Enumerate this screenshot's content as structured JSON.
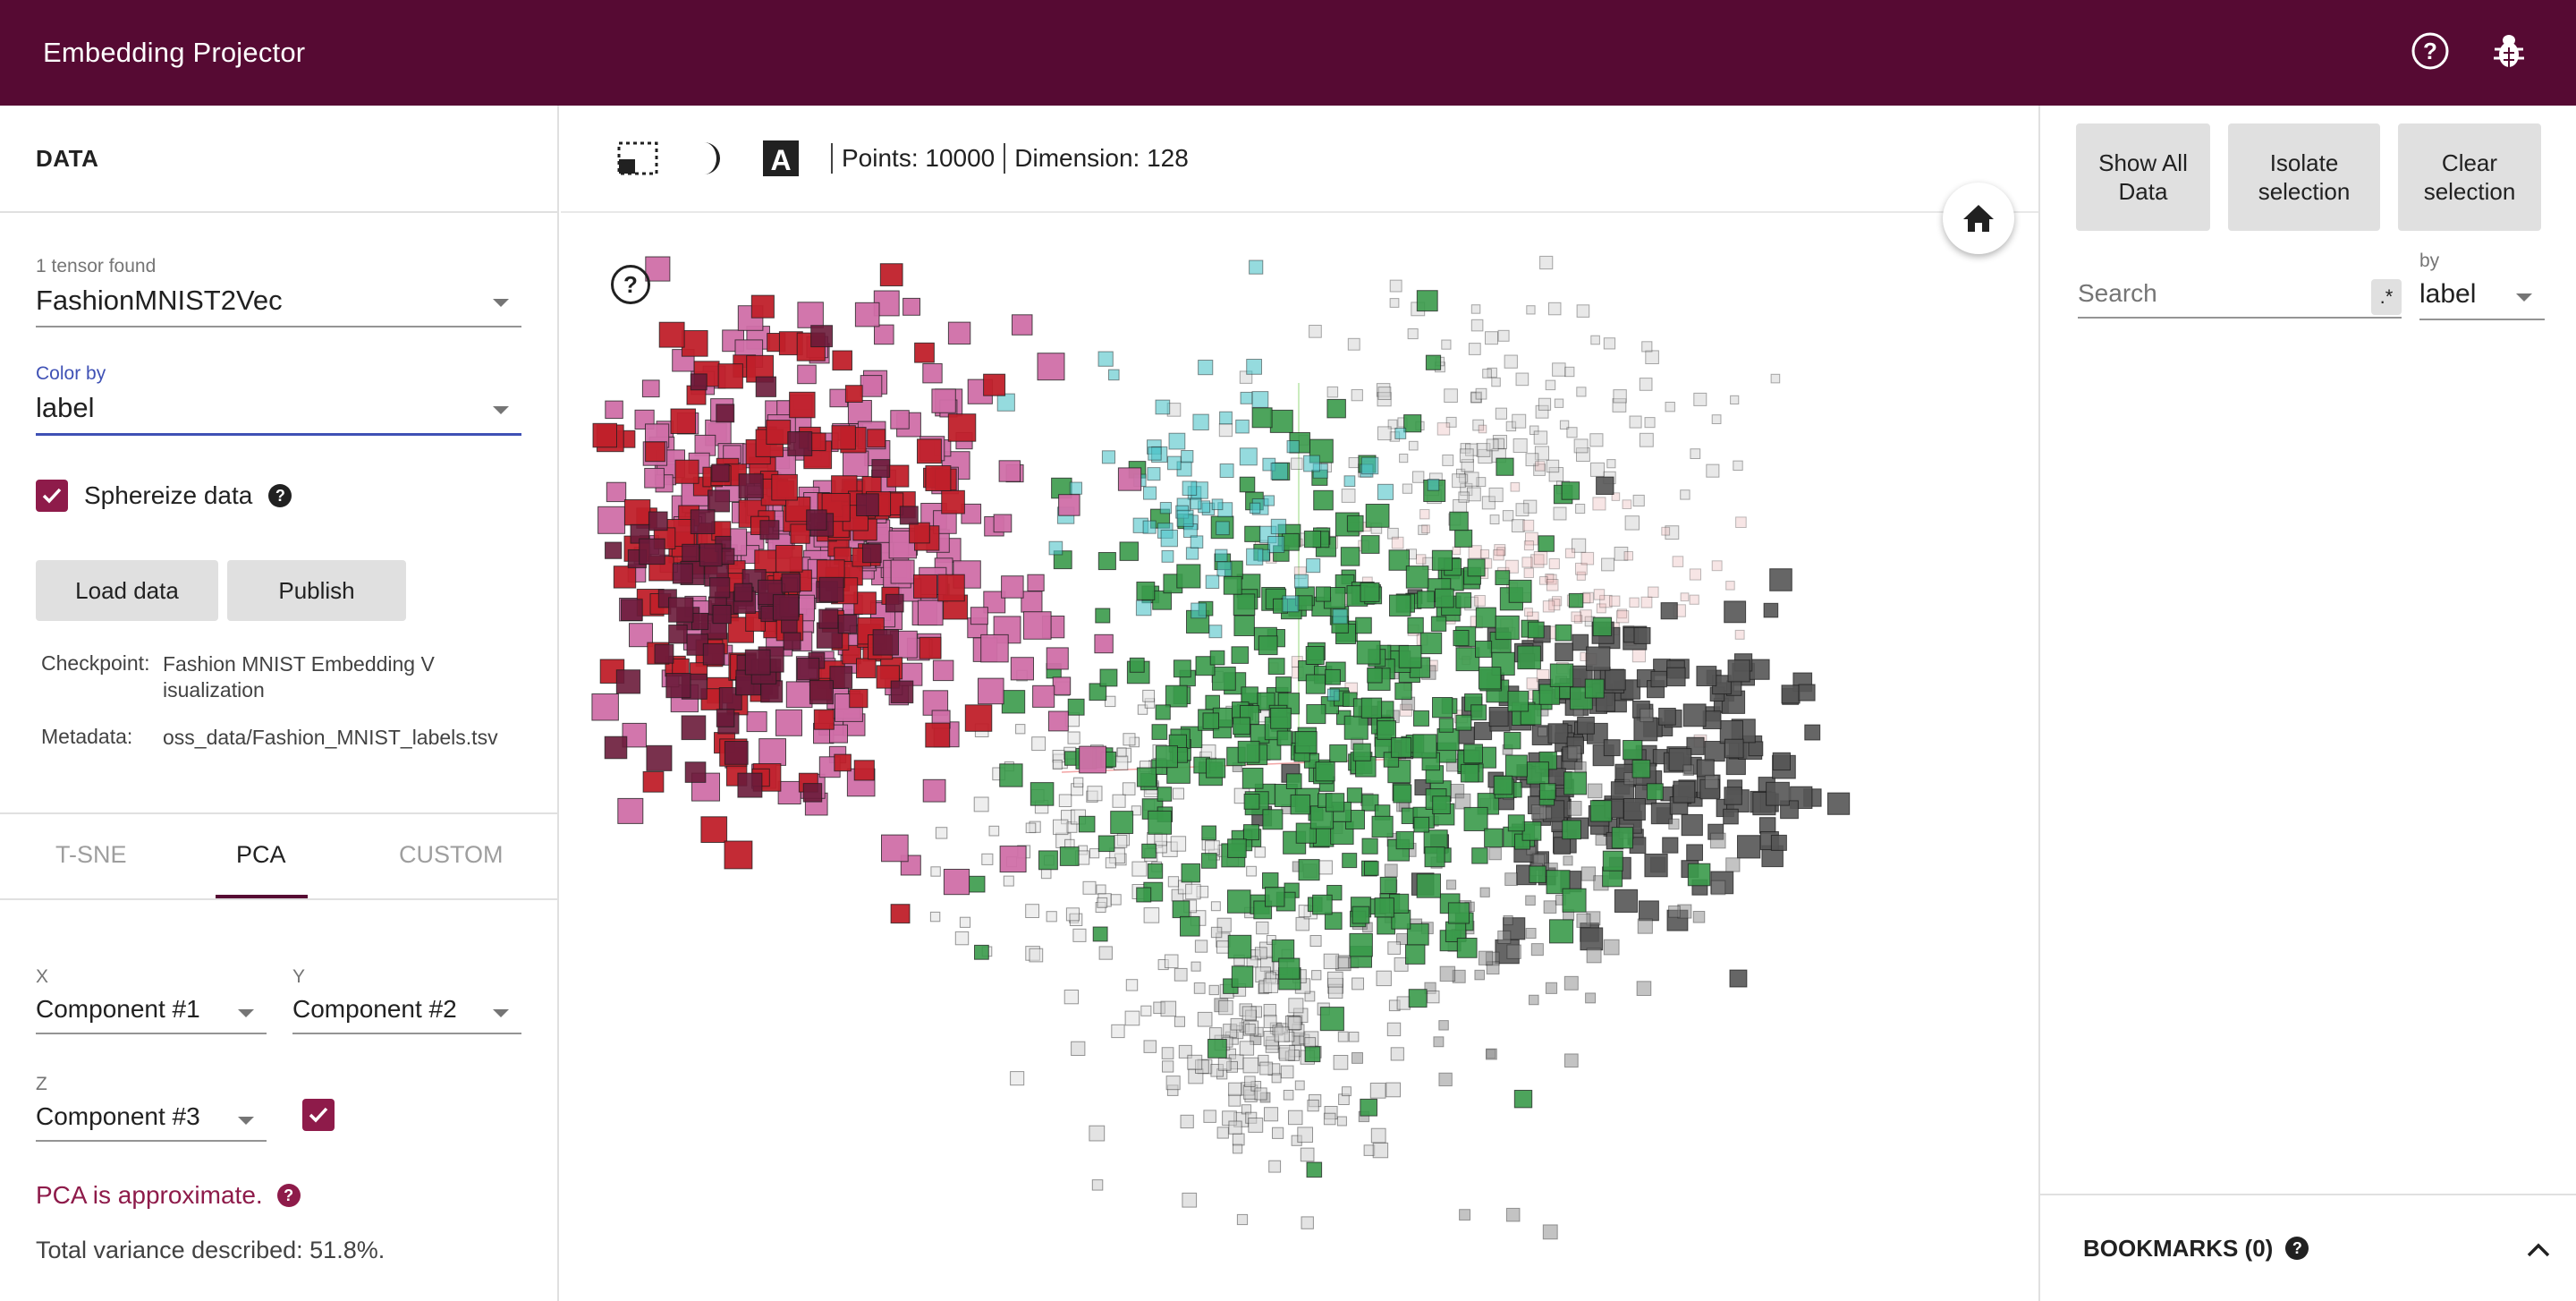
{
  "app": {
    "title": "Embedding Projector"
  },
  "header_icons": [
    "help-circle-icon",
    "bug-icon"
  ],
  "left": {
    "section_title": "DATA",
    "tensor": {
      "label": "1 tensor found",
      "value": "FashionMNIST2Vec"
    },
    "color_by": {
      "label": "Color by",
      "value": "label"
    },
    "sphereize": {
      "label": "Sphereize data",
      "checked": true
    },
    "buttons": {
      "load": "Load data",
      "publish": "Publish"
    },
    "checkpoint": {
      "key": "Checkpoint:",
      "value_line1": "Fashion MNIST Embedding V",
      "value_line2": "isualization"
    },
    "metadata": {
      "key": "Metadata:",
      "value": "oss_data/Fashion_MNIST_labels.tsv"
    },
    "tabs": [
      {
        "label": "T-SNE",
        "active": false
      },
      {
        "label": "PCA",
        "active": true
      },
      {
        "label": "CUSTOM",
        "active": false
      }
    ],
    "components": {
      "x": {
        "label": "X",
        "value": "Component #1"
      },
      "y": {
        "label": "Y",
        "value": "Component #2"
      },
      "z": {
        "label": "Z",
        "value": "Component #3",
        "enabled": true
      }
    },
    "pca_note": "PCA is approximate.",
    "variance": "Total variance described: 51.8%."
  },
  "toolbar": {
    "icons": [
      "selection-box-icon",
      "night-mode-icon",
      "labels-icon"
    ],
    "points": "Points: 10000",
    "dimension": "Dimension: 128"
  },
  "right": {
    "buttons": {
      "show_all_1": "Show All",
      "show_all_2": "Data",
      "isolate_1": "Isolate",
      "isolate_2": "selection",
      "clear_1": "Clear",
      "clear_2": "selection"
    },
    "search_placeholder": "Search",
    "regex_label": ".*",
    "by": {
      "label": "by",
      "value": "label"
    },
    "bookmarks": "BOOKMARKS (0)"
  },
  "colors": {
    "brand": "#560a33",
    "accent": "#8e1b4a",
    "cluster_pink": "#d06fa8",
    "cluster_red": "#c0202a",
    "cluster_green": "#3a9a4a",
    "cluster_gray": "#555555",
    "cluster_cyan": "#4fc3c8",
    "cluster_light": "#cccccc"
  }
}
